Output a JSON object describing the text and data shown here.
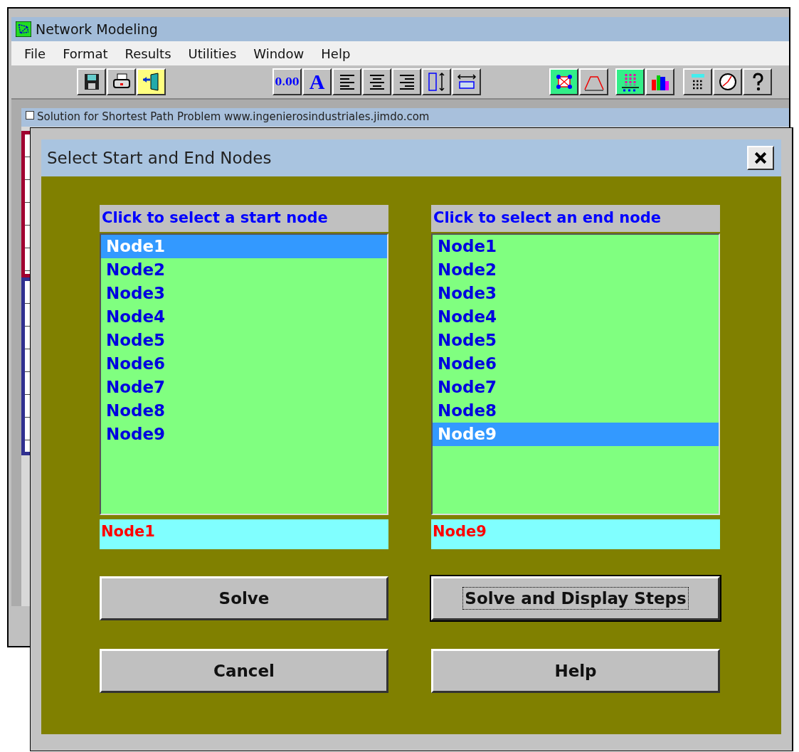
{
  "window": {
    "title": "Network Modeling"
  },
  "menu": [
    "File",
    "Format",
    "Results",
    "Utilities",
    "Window",
    "Help"
  ],
  "toolbar": [
    [
      {
        "kind": "save"
      },
      {
        "kind": "print"
      },
      {
        "kind": "exit"
      }
    ],
    [
      {
        "kind": "decimal",
        "label": "0.00"
      },
      {
        "kind": "font",
        "label": "A"
      },
      {
        "kind": "align-left"
      },
      {
        "kind": "align-center"
      },
      {
        "kind": "align-right"
      },
      {
        "kind": "row-height"
      },
      {
        "kind": "column-width"
      }
    ],
    [
      {
        "kind": "network"
      },
      {
        "kind": "graph"
      }
    ],
    [
      {
        "kind": "dots"
      },
      {
        "kind": "bars"
      }
    ],
    [
      {
        "kind": "calculator"
      },
      {
        "kind": "clock"
      },
      {
        "kind": "help"
      }
    ]
  ],
  "child_window": {
    "title": "Solution for Shortest Path Problem www.ingenierosindustriales.jimdo.com"
  },
  "dialog": {
    "title": "Select Start and End Nodes",
    "lists": [
      {
        "header": "Click to select a start node",
        "value": "Node1",
        "items": [
          {
            "label": "Node1",
            "selected": true
          },
          {
            "label": "Node2",
            "selected": false
          },
          {
            "label": "Node3",
            "selected": false
          },
          {
            "label": "Node4",
            "selected": false
          },
          {
            "label": "Node5",
            "selected": false
          },
          {
            "label": "Node6",
            "selected": false
          },
          {
            "label": "Node7",
            "selected": false
          },
          {
            "label": "Node8",
            "selected": false
          },
          {
            "label": "Node9",
            "selected": false
          }
        ]
      },
      {
        "header": "Click to select an end node",
        "value": "Node9",
        "items": [
          {
            "label": "Node1",
            "selected": false
          },
          {
            "label": "Node2",
            "selected": false
          },
          {
            "label": "Node3",
            "selected": false
          },
          {
            "label": "Node4",
            "selected": false
          },
          {
            "label": "Node5",
            "selected": false
          },
          {
            "label": "Node6",
            "selected": false
          },
          {
            "label": "Node7",
            "selected": false
          },
          {
            "label": "Node8",
            "selected": false
          },
          {
            "label": "Node9",
            "selected": true
          }
        ]
      }
    ],
    "buttons": [
      {
        "label": "Solve",
        "focused": false
      },
      {
        "label": "Solve and Display Steps",
        "focused": true
      },
      {
        "label": "Cancel",
        "focused": false
      },
      {
        "label": "Help",
        "focused": false
      }
    ]
  }
}
